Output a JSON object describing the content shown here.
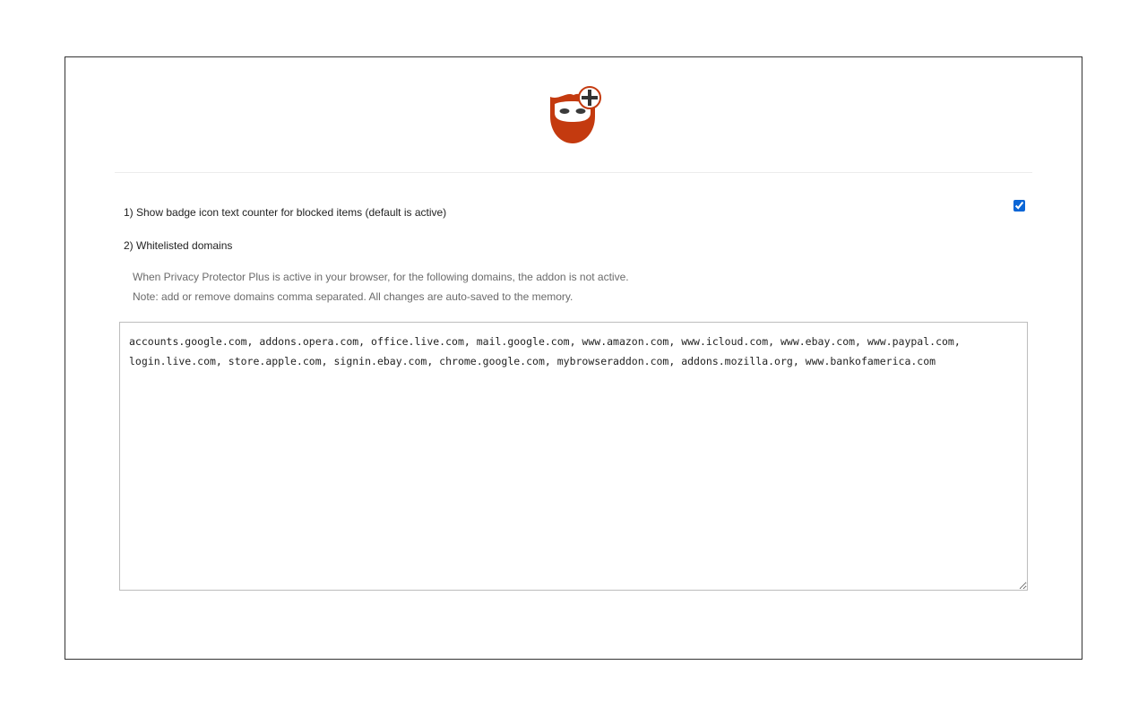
{
  "app": {
    "logo_icon": "privacy-protector-plus-logo-icon",
    "brand_color": "#c43a0f"
  },
  "options": {
    "badge_counter": {
      "label": "1) Show badge icon text counter for blocked items (default is active)",
      "checked": true
    },
    "whitelist": {
      "label": "2) Whitelisted domains",
      "description_line1": "When Privacy Protector Plus is active in your browser, for the following domains, the addon is not active.",
      "description_line2": "Note: add or remove domains comma separated. All changes are auto-saved to the memory.",
      "value": "accounts.google.com, addons.opera.com, office.live.com, mail.google.com, www.amazon.com, www.icloud.com, www.ebay.com, www.paypal.com, login.live.com, store.apple.com, signin.ebay.com, chrome.google.com, mybrowseraddon.com, addons.mozilla.org, www.bankofamerica.com"
    }
  }
}
